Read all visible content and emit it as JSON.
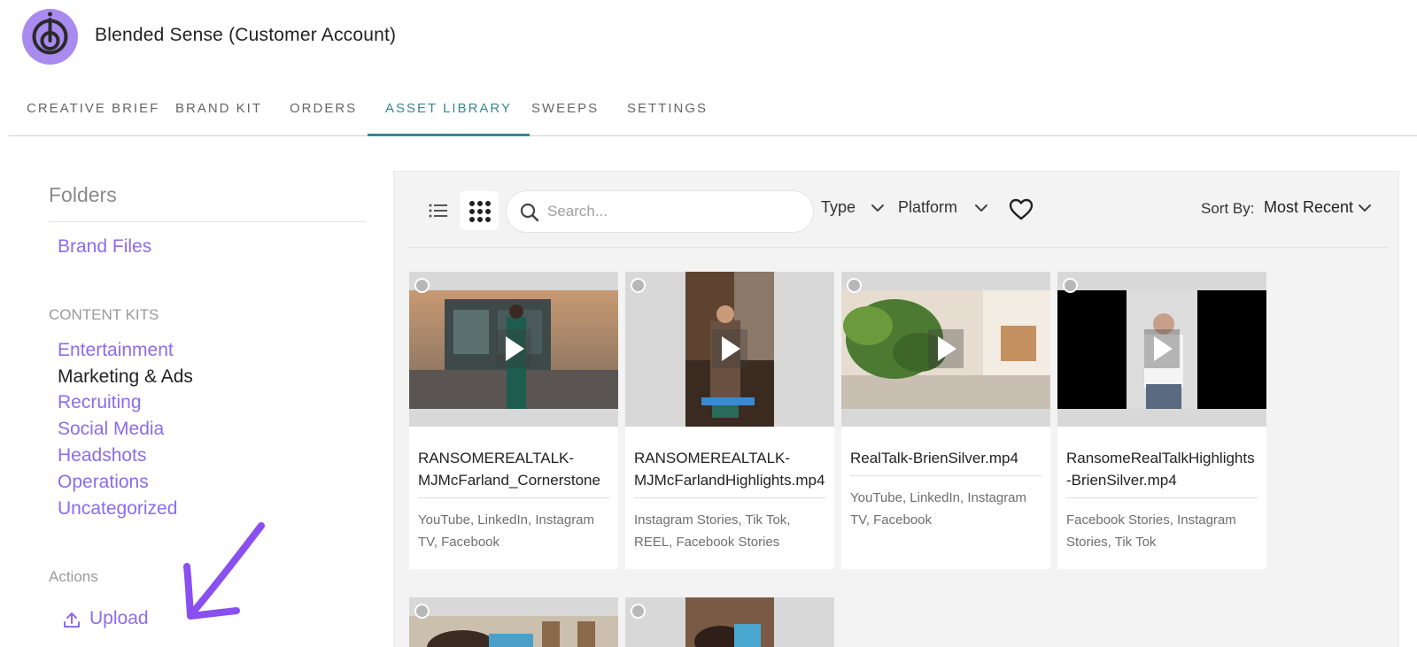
{
  "account": {
    "title": "Blended Sense (Customer Account)",
    "logo_color": "#a98bf0"
  },
  "tabs": [
    {
      "label": "CREATIVE BRIEF",
      "active": false
    },
    {
      "label": "BRAND KIT",
      "active": false
    },
    {
      "label": "ORDERS",
      "active": false
    },
    {
      "label": "ASSET LIBRARY",
      "active": true
    },
    {
      "label": "SWEEPS",
      "active": false
    },
    {
      "label": "SETTINGS",
      "active": false
    }
  ],
  "sidebar": {
    "folders_heading": "Folders",
    "brand_files": "Brand Files",
    "content_kits_heading": "CONTENT KITS",
    "kits": [
      {
        "label": "Entertainment",
        "current": false
      },
      {
        "label": "Marketing & Ads",
        "current": true
      },
      {
        "label": "Recruiting",
        "current": false
      },
      {
        "label": "Social Media",
        "current": false
      },
      {
        "label": "Headshots",
        "current": false
      },
      {
        "label": "Operations",
        "current": false
      },
      {
        "label": "Uncategorized",
        "current": false
      }
    ],
    "actions_heading": "Actions",
    "upload_label": "Upload"
  },
  "toolbar": {
    "list_view_icon": "list-icon",
    "grid_view_icon": "grid-icon",
    "view_mode": "grid",
    "search_placeholder": "Search...",
    "search_value": "",
    "type_filter": "Type",
    "platform_filter": "Platform",
    "favorites_icon": "heart-icon",
    "sort_label": "Sort By:",
    "sort_value": "Most Recent"
  },
  "assets": [
    {
      "title_line1": "RANSOMEREALTALK-",
      "title_line2": "MJMcFarland_Cornerstone",
      "platforms": "YouTube, LinkedIn, Instagram TV, Facebook",
      "orientation": "landscape"
    },
    {
      "title_line1": "RANSOMEREALTALK-",
      "title_line2": "MJMcFarlandHighlights.mp4",
      "platforms": "Instagram Stories, Tik Tok, REEL, Facebook Stories",
      "orientation": "portrait"
    },
    {
      "title_line1": "RealTalk-BrienSilver.mp4",
      "title_line2": "",
      "platforms": "YouTube, LinkedIn, Instagram TV, Facebook",
      "orientation": "landscape"
    },
    {
      "title_line1": "RansomeRealTalkHighlights-BrienSilver.mp4",
      "title_line2": "",
      "platforms": "Facebook Stories, Instagram Stories, Tik Tok",
      "orientation": "landscape"
    },
    {
      "title_line1": "",
      "title_line2": "",
      "platforms": "",
      "orientation": "landscape"
    },
    {
      "title_line1": "",
      "title_line2": "",
      "platforms": "",
      "orientation": "portrait"
    }
  ],
  "colors": {
    "accent_purple": "#8a6cf0",
    "active_tab_teal": "#3d8591",
    "panel_bg": "#f3f3f3"
  }
}
